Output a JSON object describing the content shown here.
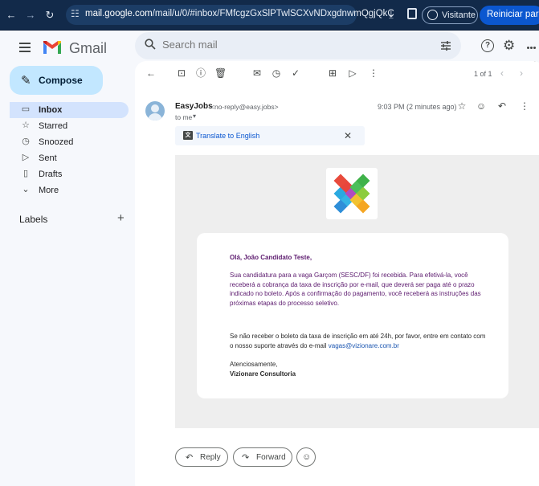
{
  "browser": {
    "url_host": "mail.google.com",
    "url_path": "/mail/u/0/#inbox/FMfcgzGxSlPTwlSCXvNDxgdnwmQgjQkC",
    "visitor_label": "Visitante",
    "reload_label": "Reiniciar para atu"
  },
  "header": {
    "app_name": "Gmail",
    "search_placeholder": "Search mail"
  },
  "sidebar": {
    "compose_label": "Compose",
    "items": [
      {
        "label": "Inbox",
        "icon": "inbox-icon"
      },
      {
        "label": "Starred",
        "icon": "star-icon"
      },
      {
        "label": "Snoozed",
        "icon": "clock-icon"
      },
      {
        "label": "Sent",
        "icon": "send-icon"
      },
      {
        "label": "Drafts",
        "icon": "draft-icon"
      },
      {
        "label": "More",
        "icon": "chevron-down-icon"
      }
    ],
    "labels_heading": "Labels"
  },
  "toolbar": {
    "pager": "1 of 1"
  },
  "message": {
    "sender_name": "EasyJobs",
    "sender_email": "<no-reply@easy.jobs>",
    "recipient": "to me",
    "timestamp": "9:03 PM (2 minutes ago)",
    "translate_label": "Translate to English"
  },
  "email_body": {
    "greeting": "Olá, João Candidato Teste,",
    "paragraph1": "Sua candidatura para a vaga Garçom (SESC/DF) foi recebida. Para efetivá-la, você receberá a cobrança da taxa de inscrição por e-mail, que deverá ser paga até o prazo indicado no boleto. Após a confirmação do pagamento, você receberá as instruções das próximas etapas do processo seletivo.",
    "paragraph2": "Se não receber o boleto da taxa de inscrição em até 24h, por favor, entre em contato com o nosso suporte através do e-mail",
    "support_email": "vagas@vizionare.com.br",
    "closing": "Atenciosamente,",
    "signature": "Vizionare Consultoria"
  },
  "actions": {
    "reply_label": "Reply",
    "forward_label": "Forward"
  },
  "colors": {
    "accent": "#0b57d0",
    "compose_bg": "#c2e7ff",
    "active_nav_bg": "#d3e3fd",
    "email_text": "#5c1a6e"
  }
}
